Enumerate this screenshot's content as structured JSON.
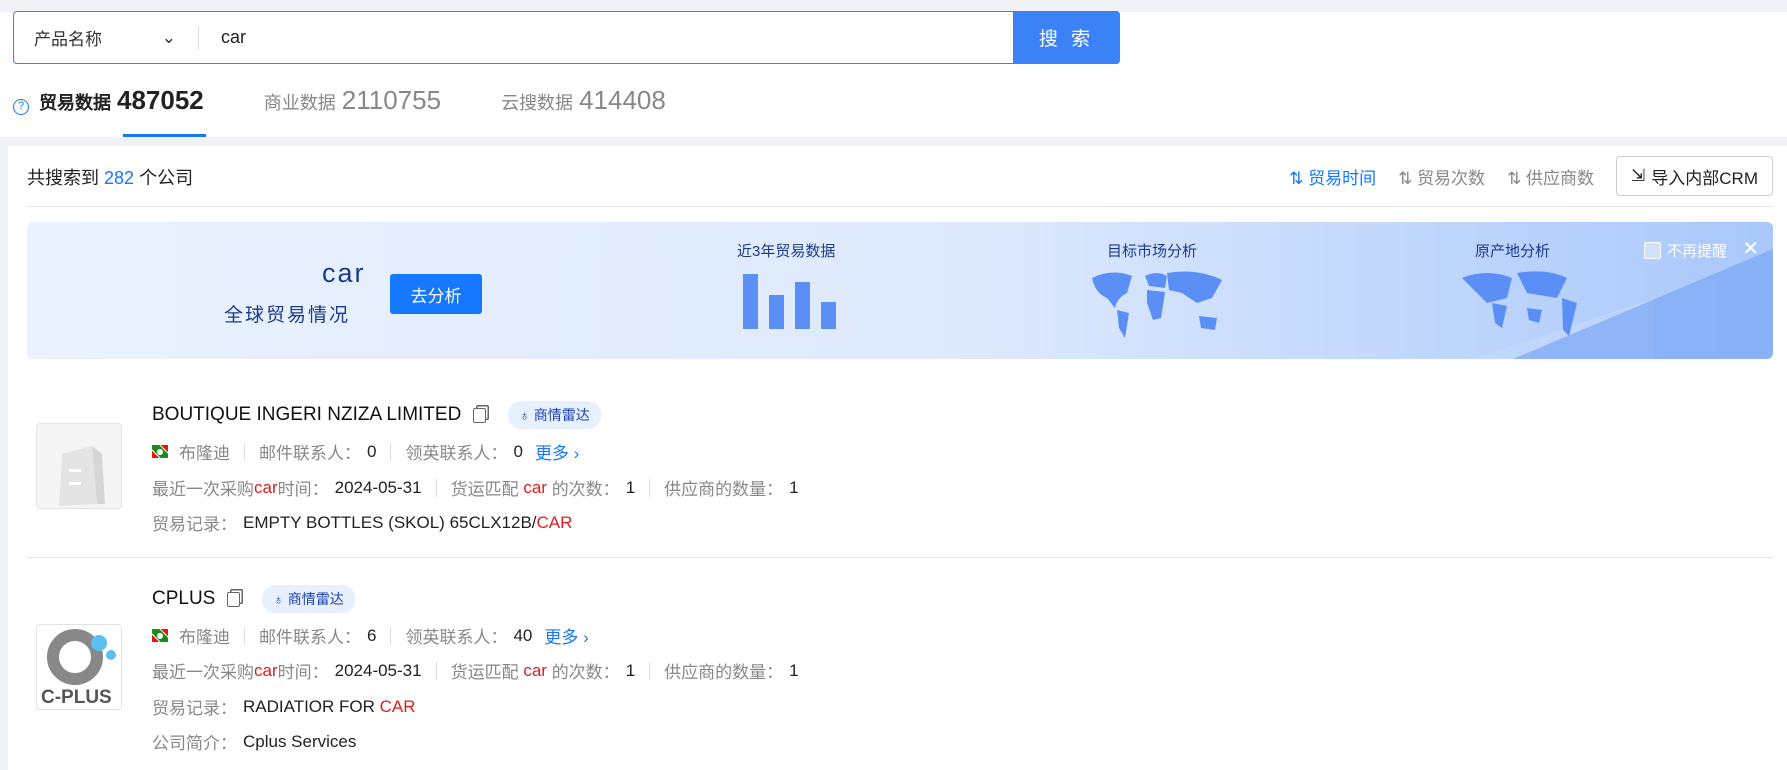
{
  "search": {
    "field": "产品名称",
    "query": "car",
    "button": "搜 索"
  },
  "tabs": [
    {
      "label": "贸易数据",
      "count": "487052",
      "active": true
    },
    {
      "label": "商业数据",
      "count": "2110755"
    },
    {
      "label": "云搜数据",
      "count": "414408"
    }
  ],
  "results": {
    "prefix": "共搜索到",
    "count": "282",
    "suffix": "个公司"
  },
  "sort": [
    "贸易时间",
    "贸易次数",
    "供应商数"
  ],
  "crm_button": "导入内部CRM",
  "banner": {
    "keyword": "car",
    "subtitle": "全球贸易情况",
    "analyze": "去分析",
    "sections": [
      "近3年贸易数据",
      "目标市场分析",
      "原产地分析"
    ],
    "no_remind": "不再提醒"
  },
  "companies": [
    {
      "name": "BOUTIQUE INGERI NZIZA LIMITED",
      "radar": "商情雷达",
      "country": "布隆迪",
      "email_label": "邮件联系人：",
      "email": "0",
      "linkedin_label": "领英联系人：",
      "linkedin": "0",
      "more": "更多",
      "last_label_a": "最近一次采购",
      "kw": "car",
      "last_label_b": "时间：",
      "last_date": "2024-05-31",
      "match_label_a": "货运匹配",
      "match_label_b": "的次数：",
      "match": "1",
      "supplier_label": "供应商的数量：",
      "suppliers": "1",
      "record_label": "贸易记录：",
      "record": "EMPTY BOTTLES (SKOL) 65CLX12B/",
      "record_kw": "CAR"
    },
    {
      "name": "CPLUS",
      "radar": "商情雷达",
      "country": "布隆迪",
      "email_label": "邮件联系人：",
      "email": "6",
      "linkedin_label": "领英联系人：",
      "linkedin": "40",
      "more": "更多",
      "last_label_a": "最近一次采购",
      "kw": "car",
      "last_label_b": "时间：",
      "last_date": "2024-05-31",
      "match_label_a": "货运匹配",
      "match_label_b": "的次数：",
      "match": "1",
      "supplier_label": "供应商的数量：",
      "suppliers": "1",
      "record_label": "贸易记录：",
      "record": "RADIATIOR FOR ",
      "record_kw": "CAR",
      "intro_label": "公司简介：",
      "intro": "Cplus Services",
      "logo_text": "C-PLUS"
    }
  ],
  "colors": {
    "accent": "#1677ff",
    "highlight": "#e11d1d"
  }
}
